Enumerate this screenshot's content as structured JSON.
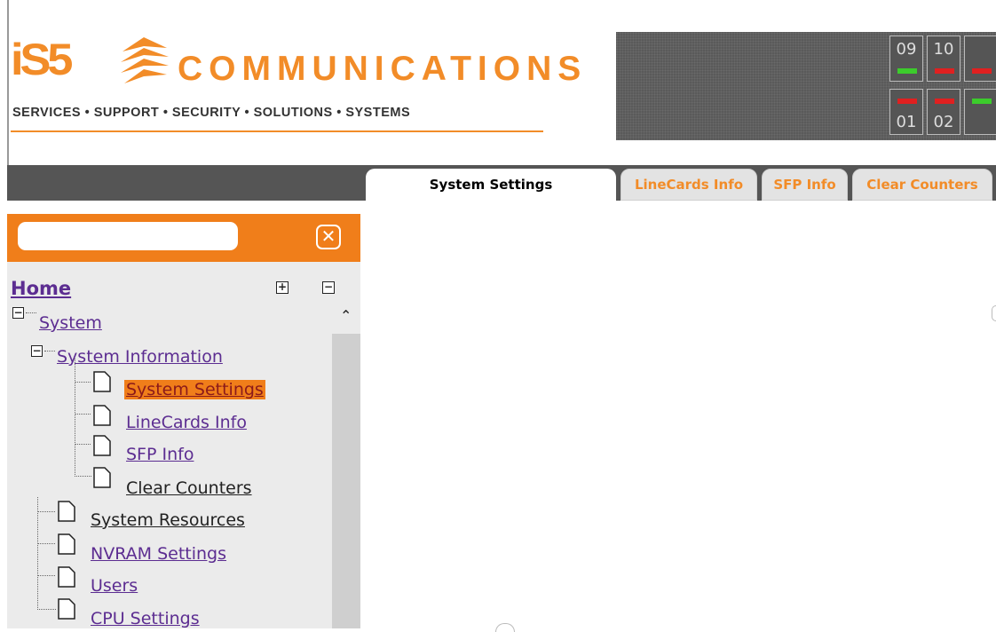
{
  "brand": {
    "logo_mark": "iS5",
    "company": "COMMUNICATIONS",
    "tagline": "SERVICES • SUPPORT • SECURITY • SOLUTIONS • SYSTEMS",
    "accent_color": "#f28c28"
  },
  "device_panel": {
    "ports_top": [
      {
        "number": "09",
        "led": "#3ccc2c"
      },
      {
        "number": "10",
        "led": "#e02020"
      }
    ],
    "ports_bottom": [
      {
        "number": "01",
        "led": "#e02020"
      },
      {
        "number": "02",
        "led": "#e02020"
      }
    ]
  },
  "tabs": [
    {
      "label": "System Settings",
      "active": true
    },
    {
      "label": "LineCards Info",
      "active": false
    },
    {
      "label": "SFP Info",
      "active": false
    },
    {
      "label": "Clear Counters",
      "active": false
    }
  ],
  "search": {
    "value": "",
    "clear_icon": "close-icon"
  },
  "tree": {
    "home": "Home",
    "expand_all_icon": "plus-box-icon",
    "collapse_all_icon": "minus-box-icon",
    "system": "System",
    "system_information": "System Information",
    "items_level2": [
      {
        "label": "System Settings",
        "selected": true
      },
      {
        "label": "LineCards Info"
      },
      {
        "label": "SFP Info"
      },
      {
        "label": "Clear Counters"
      }
    ],
    "items_level1": [
      {
        "label": "System Resources"
      },
      {
        "label": "NVRAM Settings"
      },
      {
        "label": "Users"
      },
      {
        "label": "CPU Settings"
      }
    ]
  }
}
